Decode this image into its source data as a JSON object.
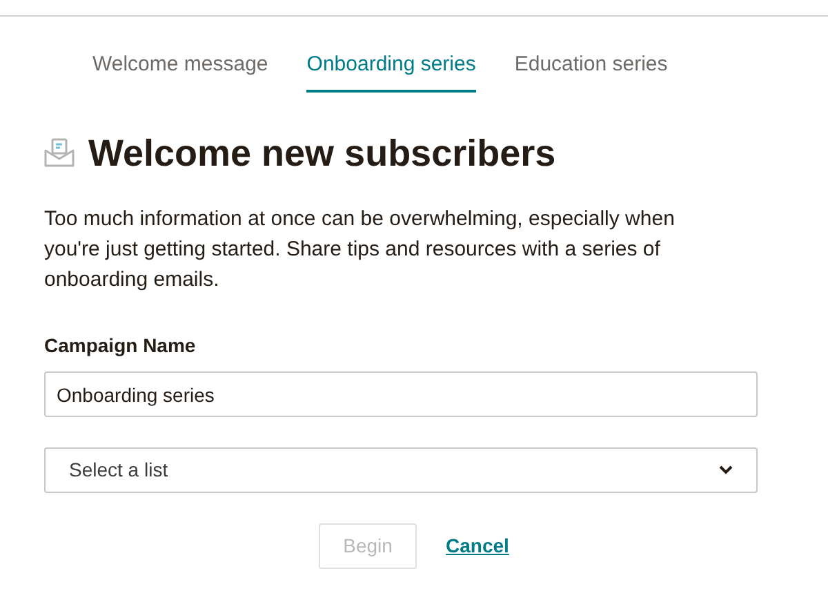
{
  "tabs": [
    {
      "label": "Welcome message",
      "selected": false
    },
    {
      "label": "Onboarding series",
      "selected": true
    },
    {
      "label": "Education series",
      "selected": false
    }
  ],
  "heading": "Welcome new subscribers",
  "description": "Too much information at once can be overwhelming, especially when you're just getting started. Share tips and resources with a series of onboarding emails.",
  "campaign_name": {
    "label": "Campaign Name",
    "value": "Onboarding series"
  },
  "list_select": {
    "placeholder": "Select a list"
  },
  "begin_button": {
    "label": "Begin",
    "disabled": true
  },
  "cancel_link": "Cancel"
}
